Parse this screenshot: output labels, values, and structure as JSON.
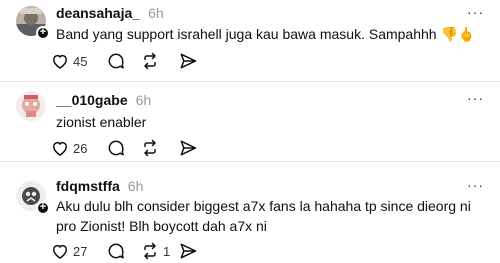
{
  "posts": [
    {
      "username": "deansahaja_",
      "time": "6h",
      "text": "Band yang support israhell juga kau bawa masuk. Sampahhh 👎🖕",
      "likes": "45",
      "reposts": "",
      "more": "···"
    },
    {
      "username": "__010gabe",
      "time": "6h",
      "text": "zionist enabler",
      "likes": "26",
      "reposts": "",
      "more": "···"
    },
    {
      "username": "fdqmstffa",
      "time": "6h",
      "text": "Aku dulu blh consider biggest a7x fans la hahaha tp since dieorg ni pro Zionist! Blh boycott dah a7x ni",
      "likes": "27",
      "reposts": "1",
      "more": "···"
    }
  ],
  "icons": {
    "like": "heart-icon",
    "reply": "comment-icon",
    "repost": "repost-icon",
    "share": "send-icon",
    "follow": "plus-icon",
    "more": "more-icon"
  },
  "colors": {
    "text": "#101010",
    "muted": "#999999",
    "divider": "#e3e3e3"
  }
}
